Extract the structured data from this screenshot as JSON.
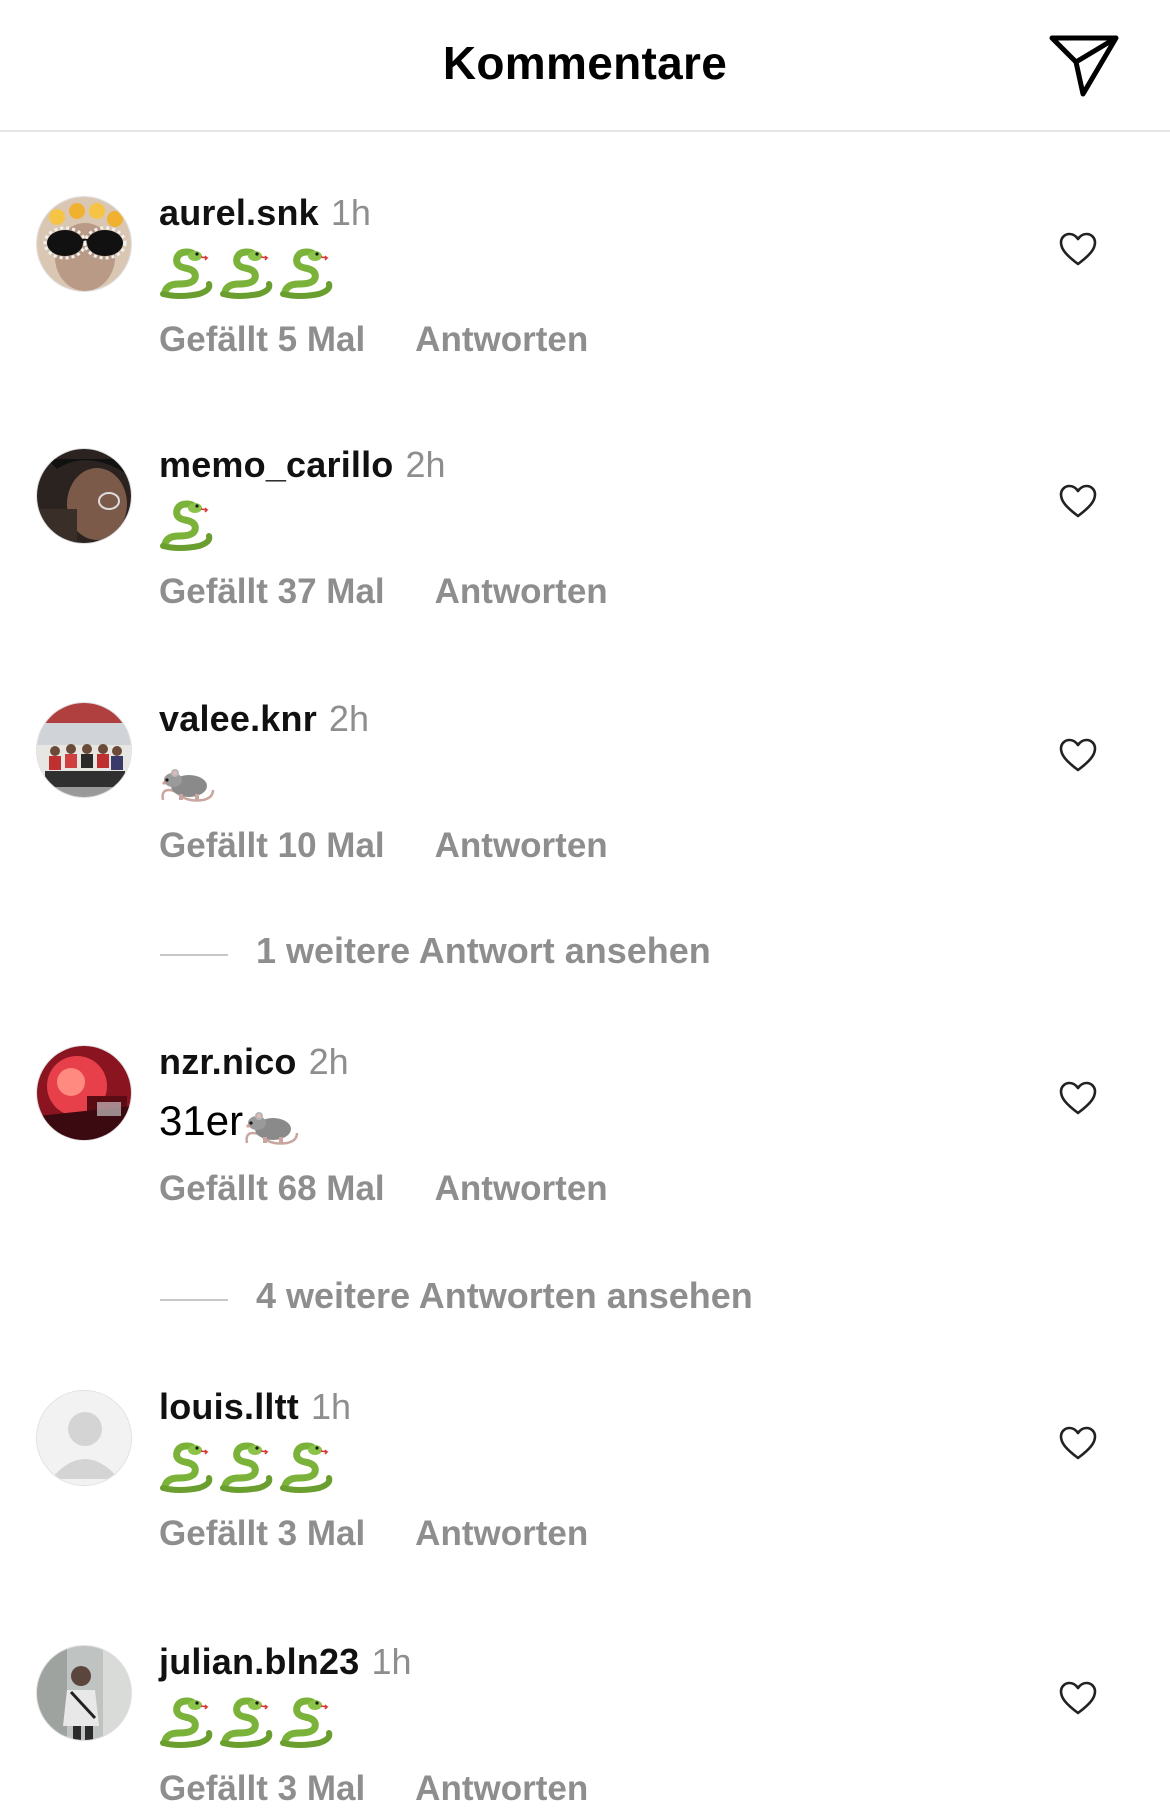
{
  "header": {
    "title": "Kommentare",
    "send_icon": "paper-plane-icon"
  },
  "comments": [
    {
      "username": "aurel.snk",
      "time": "1h",
      "text": "",
      "emojis": [
        "snake",
        "snake",
        "snake"
      ],
      "likes_label": "Gefällt 5 Mal",
      "reply_label": "Antworten",
      "avatar": "avatar-sunglasses"
    },
    {
      "username": "memo_carillo",
      "time": "2h",
      "text": "",
      "emojis": [
        "snake"
      ],
      "likes_label": "Gefällt 37 Mal",
      "reply_label": "Antworten",
      "avatar": "avatar-dark-portrait"
    },
    {
      "username": "valee.knr",
      "time": "2h",
      "text": "",
      "emojis": [
        "rat"
      ],
      "likes_label": "Gefällt 10 Mal",
      "reply_label": "Antworten",
      "avatar": "avatar-group-photo"
    },
    {
      "username": "nzr.nico",
      "time": "2h",
      "text": "31er",
      "emojis": [
        "rat"
      ],
      "likes_label": "Gefällt 68 Mal",
      "reply_label": "Antworten",
      "avatar": "avatar-red-flares"
    },
    {
      "username": "louis.lltt",
      "time": "1h",
      "text": "",
      "emojis": [
        "snake",
        "snake",
        "snake"
      ],
      "likes_label": "Gefällt 3 Mal",
      "reply_label": "Antworten",
      "avatar": "avatar-default"
    },
    {
      "username": "julian.bln23",
      "time": "1h",
      "text": "",
      "emojis": [
        "snake",
        "snake",
        "snake"
      ],
      "likes_label": "Gefällt 3 Mal",
      "reply_label": "Antworten",
      "avatar": "avatar-street-photo"
    }
  ],
  "more_replies": [
    {
      "label": "1 weitere Antwort ansehen"
    },
    {
      "label": "4 weitere Antworten ansehen"
    }
  ],
  "colors": {
    "secondary_text": "#8e8e8e",
    "divider": "#e6e6e6",
    "snake_green": "#7bb23a",
    "rat_gray": "#8a8a8a"
  }
}
